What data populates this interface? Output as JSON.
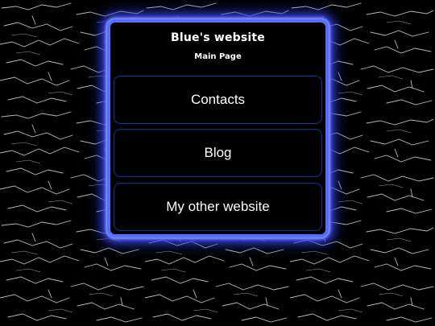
{
  "site": {
    "title": "Blue's website",
    "subtitle": "Main Page"
  },
  "nav": {
    "items": [
      {
        "label": "Contacts"
      },
      {
        "label": "Blog"
      },
      {
        "label": "My other website"
      }
    ]
  },
  "colors": {
    "background": "#000000",
    "panel_border": "#5a6cff",
    "panel_glow": "#3340e0",
    "button_border": "#1d2a88",
    "text": "#ffffff"
  }
}
